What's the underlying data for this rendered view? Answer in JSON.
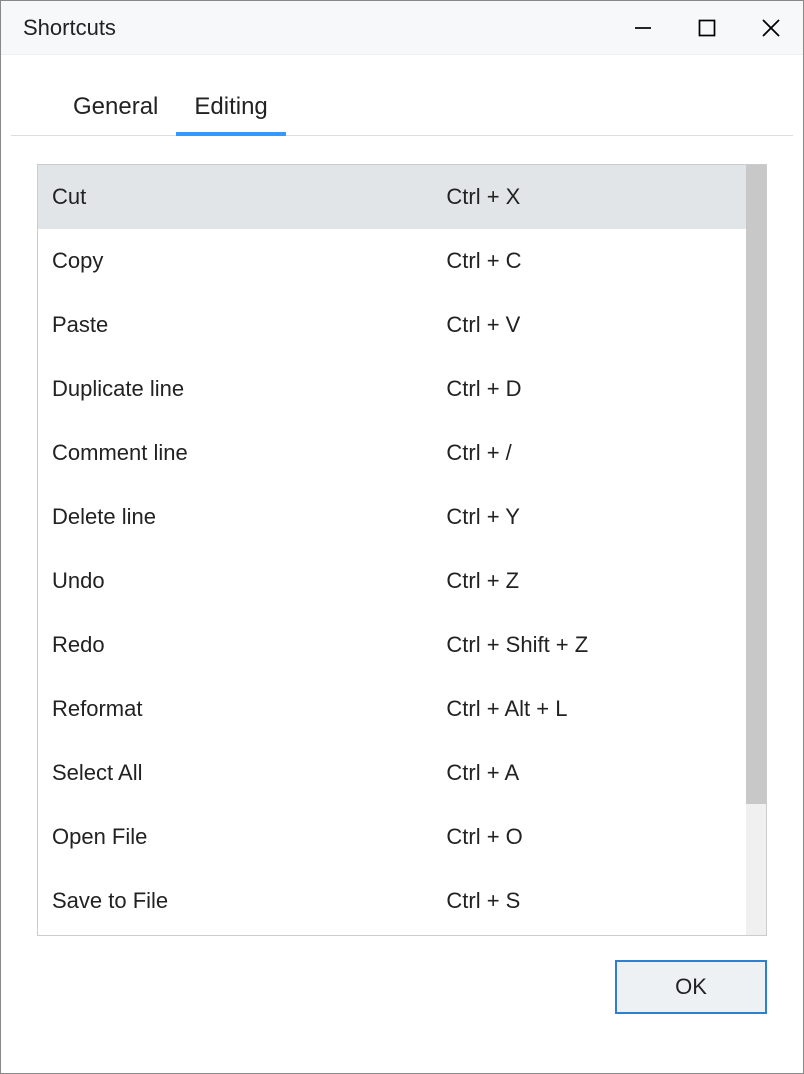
{
  "window": {
    "title": "Shortcuts"
  },
  "tabs": [
    {
      "label": "General",
      "active": false
    },
    {
      "label": "Editing",
      "active": true
    }
  ],
  "shortcuts": [
    {
      "action": "Cut",
      "keys": "Ctrl + X",
      "selected": true
    },
    {
      "action": "Copy",
      "keys": "Ctrl + C",
      "selected": false
    },
    {
      "action": "Paste",
      "keys": "Ctrl + V",
      "selected": false
    },
    {
      "action": "Duplicate line",
      "keys": "Ctrl + D",
      "selected": false
    },
    {
      "action": "Comment line",
      "keys": "Ctrl + /",
      "selected": false
    },
    {
      "action": "Delete line",
      "keys": "Ctrl + Y",
      "selected": false
    },
    {
      "action": "Undo",
      "keys": "Ctrl + Z",
      "selected": false
    },
    {
      "action": "Redo",
      "keys": "Ctrl + Shift + Z",
      "selected": false
    },
    {
      "action": "Reformat",
      "keys": "Ctrl + Alt + L",
      "selected": false
    },
    {
      "action": "Select All",
      "keys": "Ctrl + A",
      "selected": false
    },
    {
      "action": "Open File",
      "keys": "Ctrl + O",
      "selected": false
    },
    {
      "action": "Save to File",
      "keys": "Ctrl + S",
      "selected": false
    }
  ],
  "footer": {
    "ok_label": "OK"
  }
}
